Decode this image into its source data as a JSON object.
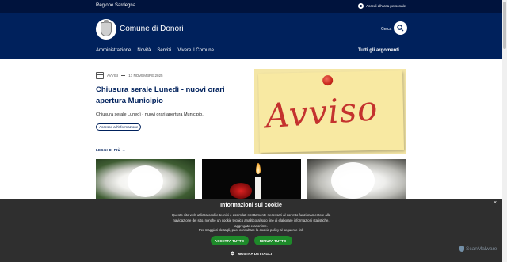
{
  "topbar": {
    "region": "Regione Sardegna",
    "access_label": "Accedi all'area personale"
  },
  "header": {
    "title": "Comune di Donori",
    "search_label": "Cerca",
    "nav": [
      "Amministrazione",
      "Novità",
      "Servizi",
      "Vivere il Comune"
    ],
    "all_topics": "Tutti gli argomenti"
  },
  "article": {
    "category": "AVVISI",
    "date": "17 NOVEMBRE 2025",
    "title": "Chiusura serale Lunedì - nuovi orari apertura Municipio",
    "description": "Chiusura serale Lunedì - nuovi orari apertura Municipio.",
    "tag": "Accesso all'informazione",
    "read_more": "LEGGI DI PIÙ"
  },
  "image": {
    "word": "Avviso"
  },
  "cookie": {
    "title": "Informazioni sui cookie",
    "body": "Questo sito web utilizza cookie tecnici e assimilati strettamente necessari al corretto funzionamento e alla navigazione del sito, nonché un cookie tecnico analitico al solo fine di elaborare informazioni statistiche, aggregate e anonime.",
    "more": "Per maggiori dettagli, puoi consultare la cookie policy al seguente link",
    "accept_all": "ACCETTA TUTTO",
    "reject_all": "RIFIUTA TUTTO",
    "details": "MOSTRA DETTAGLI",
    "close": "×"
  },
  "watermark": "ScanMalware",
  "colors": {
    "topbar": "#00133d",
    "header": "#00215c",
    "cookie_bg": "#2f2f2f",
    "button_green": "#1e8a2a",
    "avviso_red": "#c4322e"
  },
  "icons": [
    "user-icon",
    "search-icon",
    "calendar-icon",
    "arrow-right-icon",
    "gear-icon",
    "close-icon",
    "crest-icon"
  ]
}
